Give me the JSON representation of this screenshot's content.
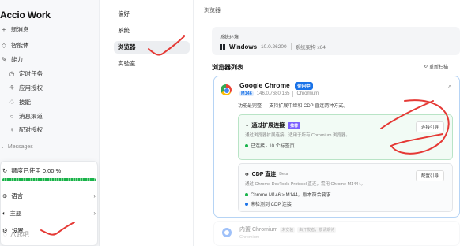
{
  "app": {
    "brand": "Accio Work"
  },
  "sidebar": {
    "items": [
      {
        "icon": "plus-icon",
        "label": "新消息"
      },
      {
        "icon": "agent-icon",
        "label": "智能体"
      },
      {
        "icon": "tool-icon",
        "label": "能力"
      },
      {
        "icon": "clock-icon",
        "label": "定时任务"
      },
      {
        "icon": "app-auth-icon",
        "label": "应用授权"
      },
      {
        "icon": "skill-icon",
        "label": "技能"
      },
      {
        "icon": "channel-icon",
        "label": "消息渠道"
      },
      {
        "icon": "user-icon",
        "label": "配对授权"
      }
    ],
    "section_label": "Messages"
  },
  "popup": {
    "quota_text": "额度已使用 0.00 %",
    "quota_fraction": 0.0,
    "items": [
      {
        "icon": "globe-icon",
        "label": "语言"
      },
      {
        "icon": "theme-icon",
        "label": "主题"
      },
      {
        "icon": "gear-icon",
        "label": "设置"
      }
    ]
  },
  "user": {
    "name": "八起吧"
  },
  "settings_nav": {
    "items": [
      "偏好",
      "系统",
      "浏览器",
      "实验室"
    ],
    "active": "浏览器"
  },
  "main": {
    "breadcrumb": "浏览器",
    "system": {
      "label": "系统环境",
      "os": "Windows",
      "version": "10.0.26200",
      "arch": "系统架构 x64"
    },
    "list_title": "浏览器列表",
    "rescan": "重新扫描",
    "chrome": {
      "name": "Google Chrome",
      "badge": "使用中",
      "version_badge": "M146",
      "version": "146.0.7680.165",
      "vendor": "Chromium",
      "desc": "功能最完整 — 支持扩展中继和 CDP 直连两种方式。",
      "ext": {
        "title": "通过扩展连接",
        "badge": "推荐",
        "desc": "通过浏览器扩展连接，适用于所有 Chromium 浏览器。",
        "status": "已连接 · 10 个标签页",
        "button": "连接引导"
      },
      "cdp": {
        "title": "CDP 直连",
        "beta": "Beta",
        "desc": "通过 Chrome DevTools Protocol 直连，需用 Chrome M144+。",
        "line1": "Chrome M146 ≥ M144，版本符合要求",
        "line2": "未检测到 CDP 连接",
        "button": "配置引导"
      }
    },
    "builtin": {
      "name": "内置 Chromium",
      "tags": [
        "未安装",
        "由开发者，敬请期待"
      ],
      "sub": "Chromium"
    }
  },
  "colors": {
    "accent": "#1a73e8",
    "success": "#18b34a",
    "annotation": "#e53935"
  }
}
